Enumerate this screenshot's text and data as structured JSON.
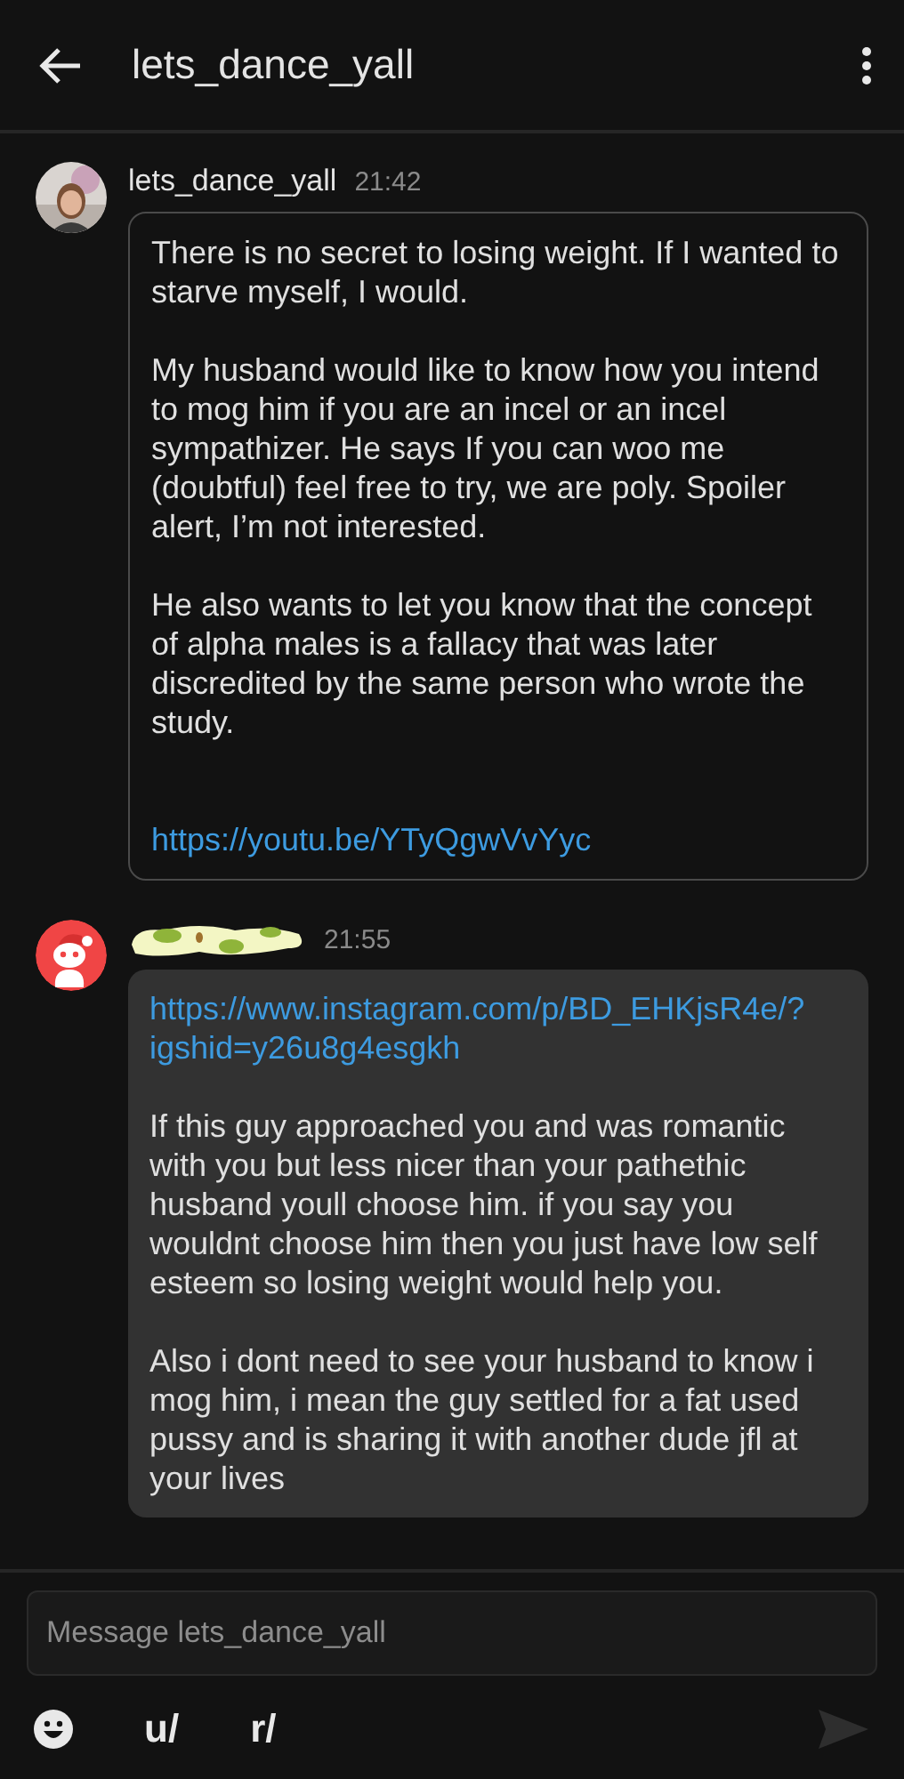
{
  "header": {
    "title": "lets_dance_yall"
  },
  "messages": [
    {
      "author": "lets_dance_yall",
      "author_hidden": false,
      "time": "21:42",
      "kind": "outlined",
      "paragraphs": [
        {
          "kind": "text",
          "text": "There is no secret to losing weight. If I wanted to starve myself, I would."
        },
        {
          "kind": "text",
          "text": "My husband would like to know how you intend to mog him if you are an incel or an incel sympathizer. He says If you can woo me (doubtful) feel free to try, we are poly. Spoiler alert, I’m not interested."
        },
        {
          "kind": "text",
          "text": "He also wants to let you know that the concept of alpha males is a fallacy that was later discredited by the same person who wrote the study."
        },
        {
          "kind": "spacer"
        },
        {
          "kind": "link",
          "text": "https://youtu.be/YTyQgwVvYyc"
        }
      ]
    },
    {
      "author_hidden": true,
      "avatar": {
        "kind": "robot"
      },
      "time": "21:55",
      "kind": "filled",
      "paragraphs": [
        {
          "kind": "link",
          "text": "https://www.instagram.com/p/BD_EHKjsR4e/?igshid=y26u8g4esgkh"
        },
        {
          "kind": "text",
          "text": "If this guy approached you and was romantic with you but less nicer than your pathethic husband youll choose him.  if you say you wouldnt choose him then you just have low self esteem so losing weight would help you."
        },
        {
          "kind": "text",
          "text": "Also i dont need to see your husband to know i mog him,  i mean the guy settled for a fat used pussy and is sharing it with another dude jfl at your lives"
        }
      ]
    }
  ],
  "composer": {
    "placeholder": "Message lets_dance_yall",
    "user_button": "u/",
    "community_button": "r/",
    "send_disabled": true
  }
}
